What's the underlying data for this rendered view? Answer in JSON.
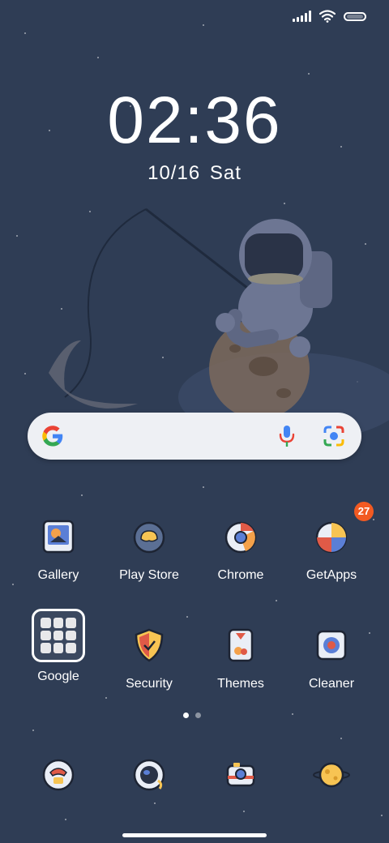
{
  "status_bar": {
    "signal_icon": "signal-icon",
    "wifi_icon": "wifi-icon",
    "battery_icon": "battery-icon"
  },
  "lockscreen_clock": {
    "time": "02:36",
    "date": "10/16",
    "weekday": "Sat"
  },
  "search_bar": {
    "logo": "google-g-icon",
    "mic": "mic-icon",
    "lens": "lens-icon"
  },
  "apps": [
    {
      "label": "Gallery",
      "icon": "gallery-icon"
    },
    {
      "label": "Play Store",
      "icon": "play-store-icon"
    },
    {
      "label": "Chrome",
      "icon": "chrome-icon"
    },
    {
      "label": "GetApps",
      "icon": "getapps-icon",
      "badge": "27"
    },
    {
      "label": "Google",
      "icon": "folder-icon"
    },
    {
      "label": "Security",
      "icon": "security-icon"
    },
    {
      "label": "Themes",
      "icon": "themes-icon"
    },
    {
      "label": "Cleaner",
      "icon": "cleaner-icon"
    }
  ],
  "page_indicator": {
    "pages": 2,
    "current": 1
  },
  "dock": [
    {
      "icon": "phone-icon"
    },
    {
      "icon": "messages-icon"
    },
    {
      "icon": "camera-icon"
    },
    {
      "icon": "browser-icon"
    }
  ],
  "colors": {
    "background": "#2f3d55",
    "badge": "#f25a22",
    "accent_blue": "#4285f4"
  }
}
